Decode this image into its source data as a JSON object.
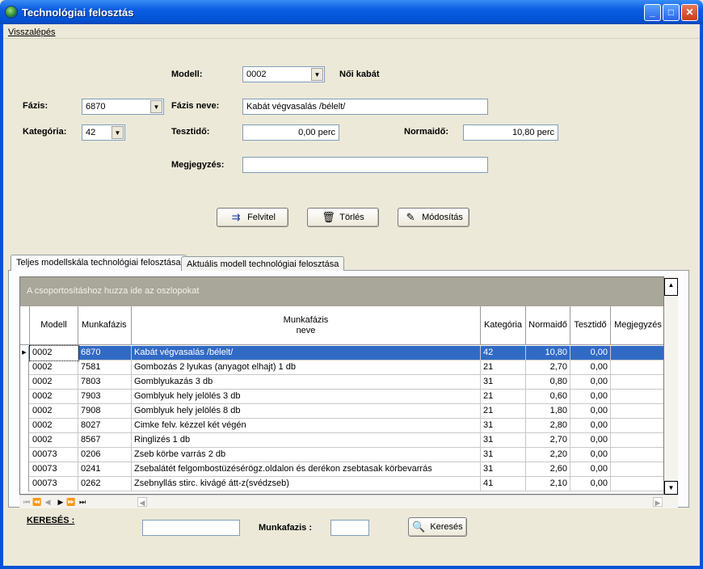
{
  "window": {
    "title": "Technológiai felosztás",
    "minimize": "_",
    "maximize": "□",
    "close": "✕"
  },
  "menu": {
    "back": "Visszalépés"
  },
  "form": {
    "modell_label": "Modell:",
    "modell_value": "0002",
    "modell_name": "Női kabát",
    "fazis_label": "Fázis:",
    "fazis_value": "6870",
    "fazis_neve_label": "Fázis neve:",
    "fazis_neve_value": "Kabát végvasalás /bélelt/",
    "kategoria_label": "Kategória:",
    "kategoria_value": "42",
    "tesztido_label": "Tesztidő:",
    "tesztido_value": "0,00 perc",
    "normaido_label": "Normaidő:",
    "normaido_value": "10,80 perc",
    "megjegyzes_label": "Megjegyzés:",
    "megjegyzes_value": ""
  },
  "buttons": {
    "felvitel": "Felvitel",
    "torles": "Törlés",
    "modositas": "Módosítás"
  },
  "tabs": [
    "Teljes modellskála technológiai felosztása",
    "Aktuális modell technológiai felosztása"
  ],
  "grid": {
    "group_hint": "A csoportosításhoz huzza ide az oszlopokat",
    "headers": {
      "modell": "Modell",
      "munkafazis": "Munkafázis",
      "neve_1": "Munkafázis",
      "neve_2": "neve",
      "kategoria": "Kategória",
      "normaido": "Normaidő",
      "tesztido": "Tesztidő",
      "megjegyzes": "Megjegyzés"
    },
    "rows": [
      {
        "modell": "0002",
        "munkafazis": "6870",
        "neve": "Kabát végvasalás /bélelt/",
        "kategoria": "42",
        "normaido": "10,80",
        "tesztido": "0,00",
        "megjegyzes": ""
      },
      {
        "modell": "0002",
        "munkafazis": "7581",
        "neve": "Gombozás 2 lyukas (anyagot elhajt)  1 db",
        "kategoria": "21",
        "normaido": "2,70",
        "tesztido": "0,00",
        "megjegyzes": ""
      },
      {
        "modell": "0002",
        "munkafazis": "7803",
        "neve": "Gomblyukazás              3 db",
        "kategoria": "31",
        "normaido": "0,80",
        "tesztido": "0,00",
        "megjegyzes": ""
      },
      {
        "modell": "0002",
        "munkafazis": "7903",
        "neve": "Gomblyuk hely jelölés       3 db",
        "kategoria": "21",
        "normaido": "0,60",
        "tesztido": "0,00",
        "megjegyzes": ""
      },
      {
        "modell": "0002",
        "munkafazis": "7908",
        "neve": "Gomblyuk hely jelölés       8 db",
        "kategoria": "21",
        "normaido": "1,80",
        "tesztido": "0,00",
        "megjegyzes": ""
      },
      {
        "modell": "0002",
        "munkafazis": "8027",
        "neve": "Cimke felv. kézzel két végén",
        "kategoria": "31",
        "normaido": "2,80",
        "tesztido": "0,00",
        "megjegyzes": ""
      },
      {
        "modell": "0002",
        "munkafazis": "8567",
        "neve": "Ringlizés 1 db",
        "kategoria": "31",
        "normaido": "2,70",
        "tesztido": "0,00",
        "megjegyzes": ""
      },
      {
        "modell": "00073",
        "munkafazis": "0206",
        "neve": "Zseb körbe varrás 2 db",
        "kategoria": "31",
        "normaido": "2,20",
        "tesztido": "0,00",
        "megjegyzes": ""
      },
      {
        "modell": "00073",
        "munkafazis": "0241",
        "neve": "Zsebalátét felgombostüzésérögz.oldalon és derékon zsebtasak körbevarrás",
        "kategoria": "31",
        "normaido": "2,60",
        "tesztido": "0,00",
        "megjegyzes": ""
      },
      {
        "modell": "00073",
        "munkafazis": "0262",
        "neve": "Zsebnyllás stirc. kivágé átt-z(svédzseb)",
        "kategoria": "41",
        "normaido": "2,10",
        "tesztido": "0,00",
        "megjegyzes": ""
      }
    ]
  },
  "search": {
    "label": "KERESÉS :",
    "value": "",
    "munkafazis_label": "Munkafazis :",
    "munkafazis_value": "",
    "button": "Keresés"
  },
  "colors": {
    "selection": "#316ac5",
    "titlebar": "#0454d8",
    "background": "#ece9d8"
  }
}
